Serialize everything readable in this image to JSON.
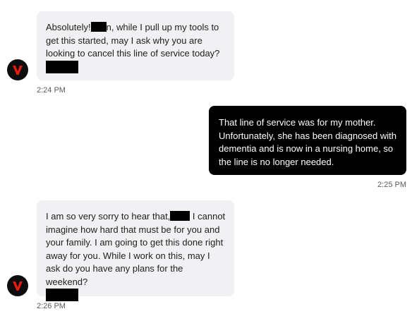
{
  "conversation": {
    "messages": [
      {
        "sender": "agent",
        "part1": "Absolutely!",
        "part2": "n, while I pull up my tools to get this started, may I ask why you are looking to cancel this line of service today?",
        "time": "2:24 PM"
      },
      {
        "sender": "user",
        "text": "That line of service was for my mother. Unfortunately, she has been diagnosed with dementia and is now in a nursing home, so the line is no longer needed.",
        "time": "2:25 PM"
      },
      {
        "sender": "agent",
        "part1": "I am so very sorry to hear that,",
        "part2": " I cannot imagine how hard that must be for you and your family. I am going to get this done right away for you. While I work on this, may I ask do you have any plans for the weekend?",
        "time": "2:26 PM"
      }
    ]
  },
  "colors": {
    "agent_bubble": "#f1f1f3",
    "user_bubble": "#000000",
    "logo_red": "#e21b10",
    "redaction": "#000000"
  },
  "icons": {
    "agent_avatar": "brand-logo-v-icon"
  }
}
